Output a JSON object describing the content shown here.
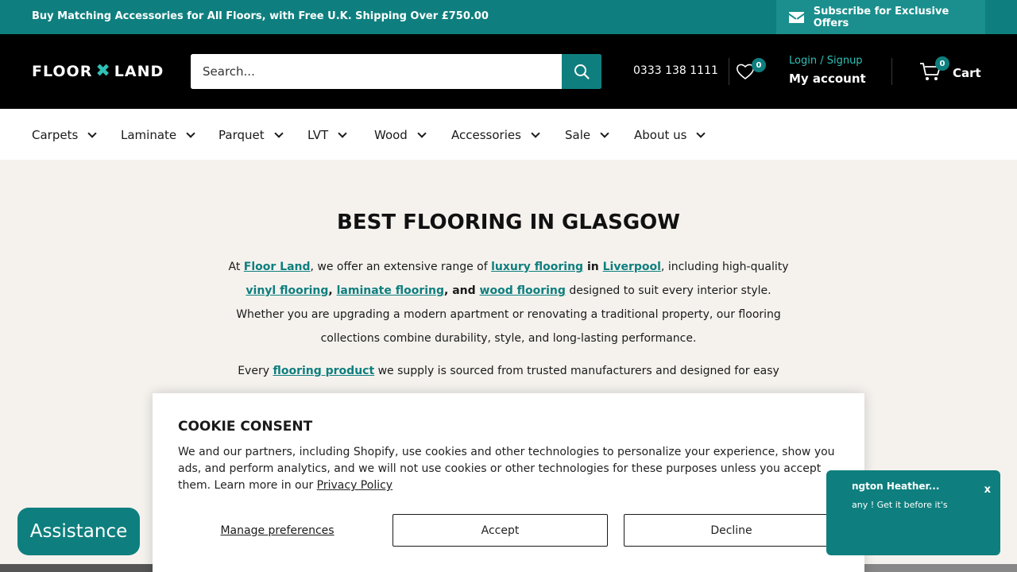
{
  "announcement": {
    "text": "Buy Matching Accessories for All Floors, with Free U.K. Shipping Over £750.00",
    "subscribe": "Subscribe for Exclusive Offers"
  },
  "header": {
    "logo_left": "FLOOR",
    "logo_right": "LAND",
    "search_placeholder": "Search...",
    "phone": "0333 138 1111",
    "wishlist_count": "0",
    "login": "Login / Signup",
    "account": "My account",
    "cart_count": "0",
    "cart": "Cart"
  },
  "nav": [
    "Carpets",
    "Laminate",
    "Parquet",
    "LVT",
    "Wood",
    "Accessories",
    "Sale",
    "About us"
  ],
  "main": {
    "title": "BEST FLOORING IN GLASGOW",
    "p1": {
      "a": "At ",
      "l1": "Floor Land",
      "b": ", we offer an extensive range of ",
      "l2": "luxury flooring",
      "c": " in ",
      "l3": "Liverpool",
      "d": ", including high-quality ",
      "l4": "vinyl flooring",
      "e": ", ",
      "l5": "laminate flooring",
      "f": ", and ",
      "l6": "wood flooring",
      "g": " designed to suit every interior style. Whether you are upgrading a modern apartment or renovating a traditional property, our flooring collections combine durability, style, and long-lasting performance."
    },
    "p2": {
      "a": "Every ",
      "l1": "flooring product",
      "b": " we supply is sourced from trusted manufacturers and designed for easy"
    }
  },
  "cookie": {
    "title": "COOKIE CONSENT",
    "text": "We and our partners, including Shopify, use cookies and other technologies to personalize your experience, show you ads, and perform analytics, and we will not use cookies or other technologies for these purposes unless you accept them. Learn more in our ",
    "policy": "Privacy Policy",
    "manage": "Manage preferences",
    "accept": "Accept",
    "decline": "Decline"
  },
  "assistance": "Assistance",
  "popup": {
    "title": "ngton Heather...",
    "desc": "any ! Get it before it's",
    "close": "x"
  }
}
